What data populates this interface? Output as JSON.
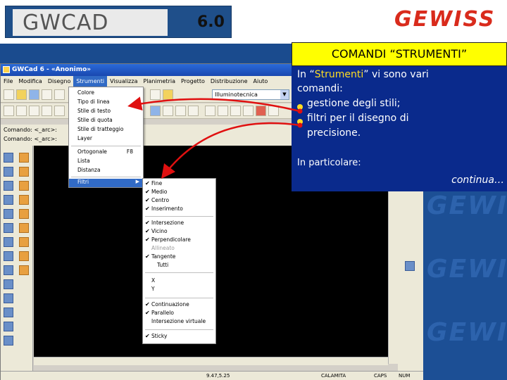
{
  "slide": {
    "logo_left": "GWCAD",
    "version": "6.0",
    "logo_right": "GEWISS",
    "watermark": "GEWISS"
  },
  "app": {
    "title": "GWCad 6 - «Anonimo»",
    "menus": [
      "File",
      "Modifica",
      "Disegno",
      "Strumenti",
      "Visualizza",
      "Planimetria",
      "Progetto",
      "Distribuzione",
      "Aiuto"
    ],
    "active_menu": "Strumenti",
    "combo_value": "Illuminotecnica",
    "command_lines": [
      "Comando: <_arc>:",
      "Comando: <_arc>:"
    ],
    "status": {
      "coords": "9.47,5.25",
      "model": "CALAMITA",
      "cap": "CAPS",
      "num": "NUM"
    }
  },
  "strumenti_menu": {
    "items": [
      {
        "label": "Colore"
      },
      {
        "label": "Tipo di linea"
      },
      {
        "label": "Stile di testo"
      },
      {
        "label": "Stile di quota"
      },
      {
        "label": "Stile di tratteggio"
      },
      {
        "label": "Layer"
      },
      {
        "label": "Ortogonale",
        "shortcut": "F8"
      },
      {
        "label": "Lista"
      },
      {
        "label": "Distanza"
      },
      {
        "label": "Filtri",
        "submenu": true,
        "highlighted": true
      }
    ]
  },
  "filtri_menu": {
    "items": [
      {
        "label": "Fine",
        "checked": true
      },
      {
        "label": "Medio",
        "checked": true
      },
      {
        "label": "Centro",
        "checked": true
      },
      {
        "label": "Inserimento",
        "checked": true
      },
      {
        "label": "Intersezione",
        "checked": true
      },
      {
        "label": "Vicino",
        "checked": true
      },
      {
        "label": "Perpendicolare",
        "checked": true
      },
      {
        "label": "Allineato",
        "disabled": true
      },
      {
        "label": "Tangente",
        "checked": true
      },
      {
        "label": "Tutti"
      },
      {
        "label": "X"
      },
      {
        "label": "Y"
      },
      {
        "label": "Continuazione",
        "checked": true
      },
      {
        "label": "Parallelo",
        "checked": true
      },
      {
        "label": "Intersezione virtuale"
      },
      {
        "label": "Sticky",
        "checked": true
      }
    ]
  },
  "callout": {
    "title": "COMANDI “STRUMENTI”",
    "intro_pre": "In “",
    "intro_hl": "Strumenti",
    "intro_post": "” vi sono vari",
    "intro_line2": "comandi:",
    "bullet1": "gestione degli stili;",
    "bullet2": "filtri per il disegno di",
    "bullet2_cont": "precisione.",
    "particular": "In particolare:",
    "continua": "continua…"
  },
  "colors": {
    "callout_title_bg": "#ffff00",
    "callout_body_bg": "#0a2a8c",
    "highlight_text": "#ffdd22",
    "arrow": "#e01010",
    "slide_blue": "#1a4b8e"
  }
}
